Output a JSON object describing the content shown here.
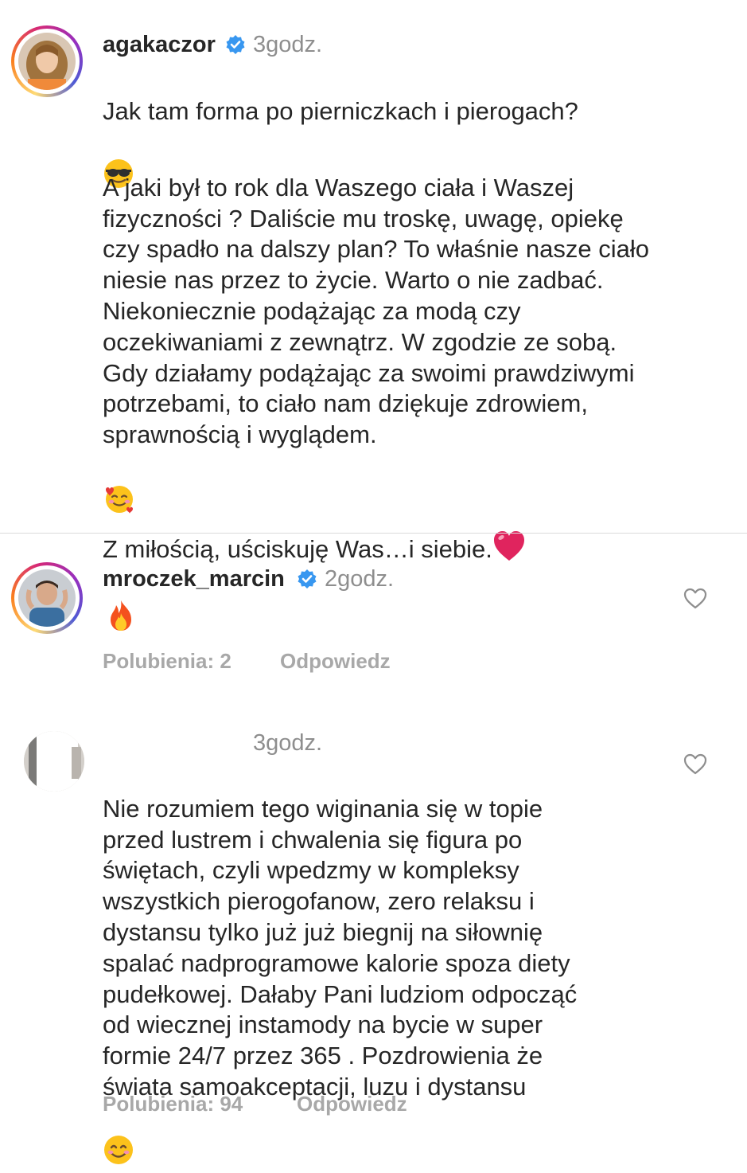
{
  "caption": {
    "username": "agakaczor",
    "time": "3godz.",
    "line1": "Jak tam forma po pierniczkach i pierogach?",
    "para1": "A jaki był to rok dla Waszego ciała i Waszej\nfizyczności ? Daliście mu troskę, uwagę, opiekę\nczy spadło na dalszy plan? To właśnie nasze ciało\nniesie nas przez to życie. Warto o nie zadbać.\nNiekoniecznie podążając za modą czy\noczekiwaniami z zewnątrz. W zgodzie ze sobą.\nGdy działamy podążając za swoimi prawdziwymi\npotrzebami, to ciało nam dziękuje zdrowiem,\nsprawnością i wyglądem.",
    "closing": "Z miłością, uściskuję Was…i siebie."
  },
  "comments": [
    {
      "username": "mroczek_marcin",
      "time": "2godz.",
      "likes_label": "Polubienia: 2",
      "reply_label": "Odpowiedz"
    },
    {
      "username": "",
      "time": "3godz.",
      "text": "Nie rozumiem tego wiginania się w topie\nprzed lustrem i chwalenia się figura po\nświętach, czyli wpedzmy w kompleksy\nwszystkich pierogofanow, zero relaksu i\ndystansu tylko już już biegnij na siłownię\nspalać nadprogramowe kalorie spoza diety\npudełkowej. Dałaby Pani ludziom odpocząć\nod wiecznej instamody na bycie w super\nformie 24/7 przez 365 . Pozdrowienia że\nświata samoakceptacji, luzu i dystansu",
      "likes_label": "Polubienia: 94",
      "reply_label": "Odpowiedz"
    }
  ],
  "colors": {
    "verified": "#3897f0",
    "meta_text": "#a8a8a8",
    "time_text": "#8e8e8e",
    "heart_emoji": "#e0245e"
  },
  "icons": [
    "verified-badge-icon",
    "heart-icon",
    "sunglasses-emoji",
    "smiling-hearts-emoji",
    "red-heart-emoji",
    "fire-emoji",
    "smile-emoji"
  ]
}
